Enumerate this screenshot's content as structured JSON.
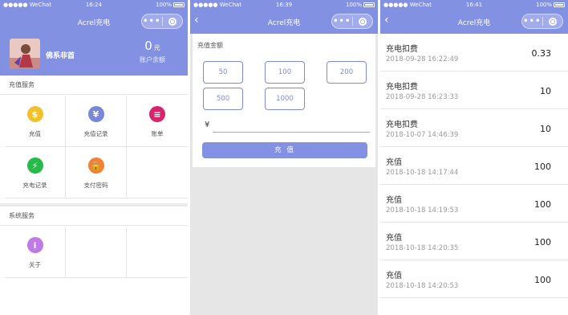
{
  "status": {
    "carrier": "●●●●● WeChat",
    "battery": "100%",
    "screen1_time": "16:24",
    "screen2_time": "16:39",
    "screen3_time": "16:41"
  },
  "nav": {
    "title": "Acrel充电",
    "back_glyph": "‹",
    "more_glyph": "•••"
  },
  "home": {
    "username": "佛系非酋",
    "balance_value": "0",
    "balance_unit": "元",
    "balance_label": "账户余额",
    "charge_services_title": "充值服务",
    "system_services_title": "系统服务",
    "services": [
      {
        "label": "充值",
        "icon": "money-bag-icon",
        "color": "#f2c02d",
        "glyph": "$"
      },
      {
        "label": "充值记录",
        "icon": "receipt-icon",
        "color": "#7a86d6",
        "glyph": "¥"
      },
      {
        "label": "账单",
        "icon": "bill-icon",
        "color": "#d8236e",
        "glyph": "≡"
      },
      {
        "label": "充电记录",
        "icon": "lightning-icon",
        "color": "#27b94a",
        "glyph": "⚡"
      },
      {
        "label": "支付密码",
        "icon": "lock-icon",
        "color": "#f08232",
        "glyph": "🔒"
      }
    ],
    "system": [
      {
        "label": "关于",
        "icon": "info-icon",
        "color": "#c07ae6",
        "glyph": "i"
      }
    ]
  },
  "recharge": {
    "title": "充值金额",
    "amounts": [
      "50",
      "100",
      "200",
      "500",
      "1000"
    ],
    "currency_symbol": "¥",
    "input_value": "",
    "submit_label": "充 值"
  },
  "records": [
    {
      "title": "充电扣费",
      "datetime": "2018-09-28 16:22:49",
      "amount": "0.33"
    },
    {
      "title": "充电扣费",
      "datetime": "2018-09-28 16:23:33",
      "amount": "10"
    },
    {
      "title": "充电扣费",
      "datetime": "2018-10-07 14:46:39",
      "amount": "10"
    },
    {
      "title": "充值",
      "datetime": "2018-10-18 14:17:44",
      "amount": "100"
    },
    {
      "title": "充值",
      "datetime": "2018-10-18 14:19:53",
      "amount": "100"
    },
    {
      "title": "充值",
      "datetime": "2018-10-18 14:20:35",
      "amount": "100"
    },
    {
      "title": "充值",
      "datetime": "2018-10-18 14:20:53",
      "amount": "100"
    }
  ]
}
